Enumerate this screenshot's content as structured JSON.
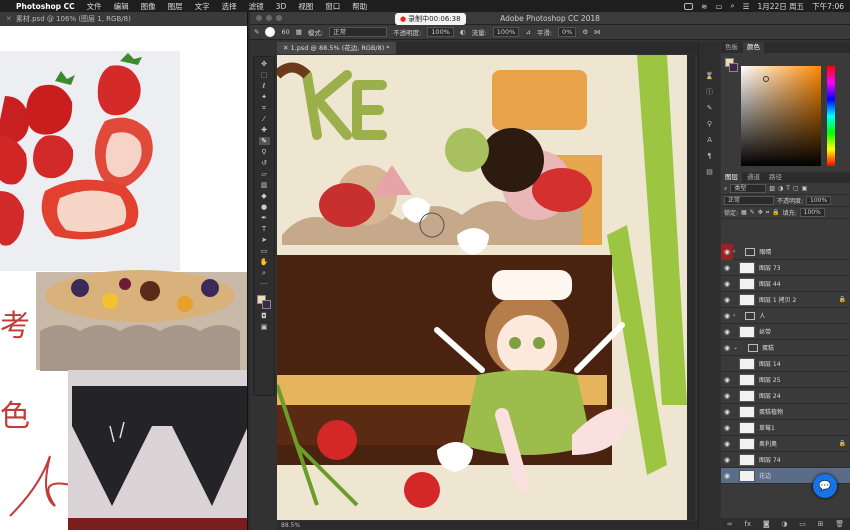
{
  "menubar": {
    "app_name": "Photoshop CC",
    "items": [
      "文件",
      "编辑",
      "图像",
      "图层",
      "文字",
      "选择",
      "滤镜",
      "3D",
      "视图",
      "窗口",
      "帮助"
    ],
    "date": "1月22日 周五",
    "time": "下午7:06"
  },
  "reference_window": {
    "title": "素材.psd @ 106% (图层 1, RGB/8)"
  },
  "photoshop": {
    "window_title": "Adobe Photoshop CC 2018",
    "recording": "录制中00:06:38",
    "options": {
      "brush_size": "60",
      "mode_label": "模式:",
      "mode_value": "正常",
      "opacity_label": "不透明度:",
      "opacity_value": "100%",
      "flow_label": "流量:",
      "flow_value": "100%",
      "smooth_label": "平滑:",
      "smooth_value": "0%"
    },
    "document_tab": "1.psd @ 88.5% (花边, RGB/8) *",
    "zoom_status": "88.5%",
    "colors": {
      "foreground": "#f0d9b8",
      "background": "#3a2a44"
    }
  },
  "color_panel": {
    "tabs": [
      "色板",
      "颜色"
    ]
  },
  "layers_panel": {
    "tabs": [
      "图层",
      "通道",
      "路径"
    ],
    "kind_filter": "类型",
    "blend_mode": "正常",
    "opacity_label": "不透明度:",
    "opacity_value": "100%",
    "lock_label": "锁定:",
    "fill_label": "填充:",
    "fill_value": "100%",
    "layers": [
      {
        "name": "眼睛",
        "type": "folder",
        "eye": "red"
      },
      {
        "name": "图层 73",
        "type": "layer"
      },
      {
        "name": "图层 44",
        "type": "layer"
      },
      {
        "name": "图层 1 拷贝 2",
        "type": "layer",
        "locked": true
      },
      {
        "name": "人",
        "type": "folder"
      },
      {
        "name": "丝带",
        "type": "layer"
      },
      {
        "name": "蛋糕",
        "type": "folder"
      },
      {
        "name": "图层 14",
        "type": "layer"
      },
      {
        "name": "图层 25",
        "type": "layer"
      },
      {
        "name": "图层 24",
        "type": "layer"
      },
      {
        "name": "蛋糕植物",
        "type": "layer"
      },
      {
        "name": "草莓1",
        "type": "layer"
      },
      {
        "name": "奥利奥",
        "type": "layer",
        "locked": true
      },
      {
        "name": "图层 74",
        "type": "layer"
      },
      {
        "name": "花边",
        "type": "layer",
        "selected": true
      }
    ]
  }
}
